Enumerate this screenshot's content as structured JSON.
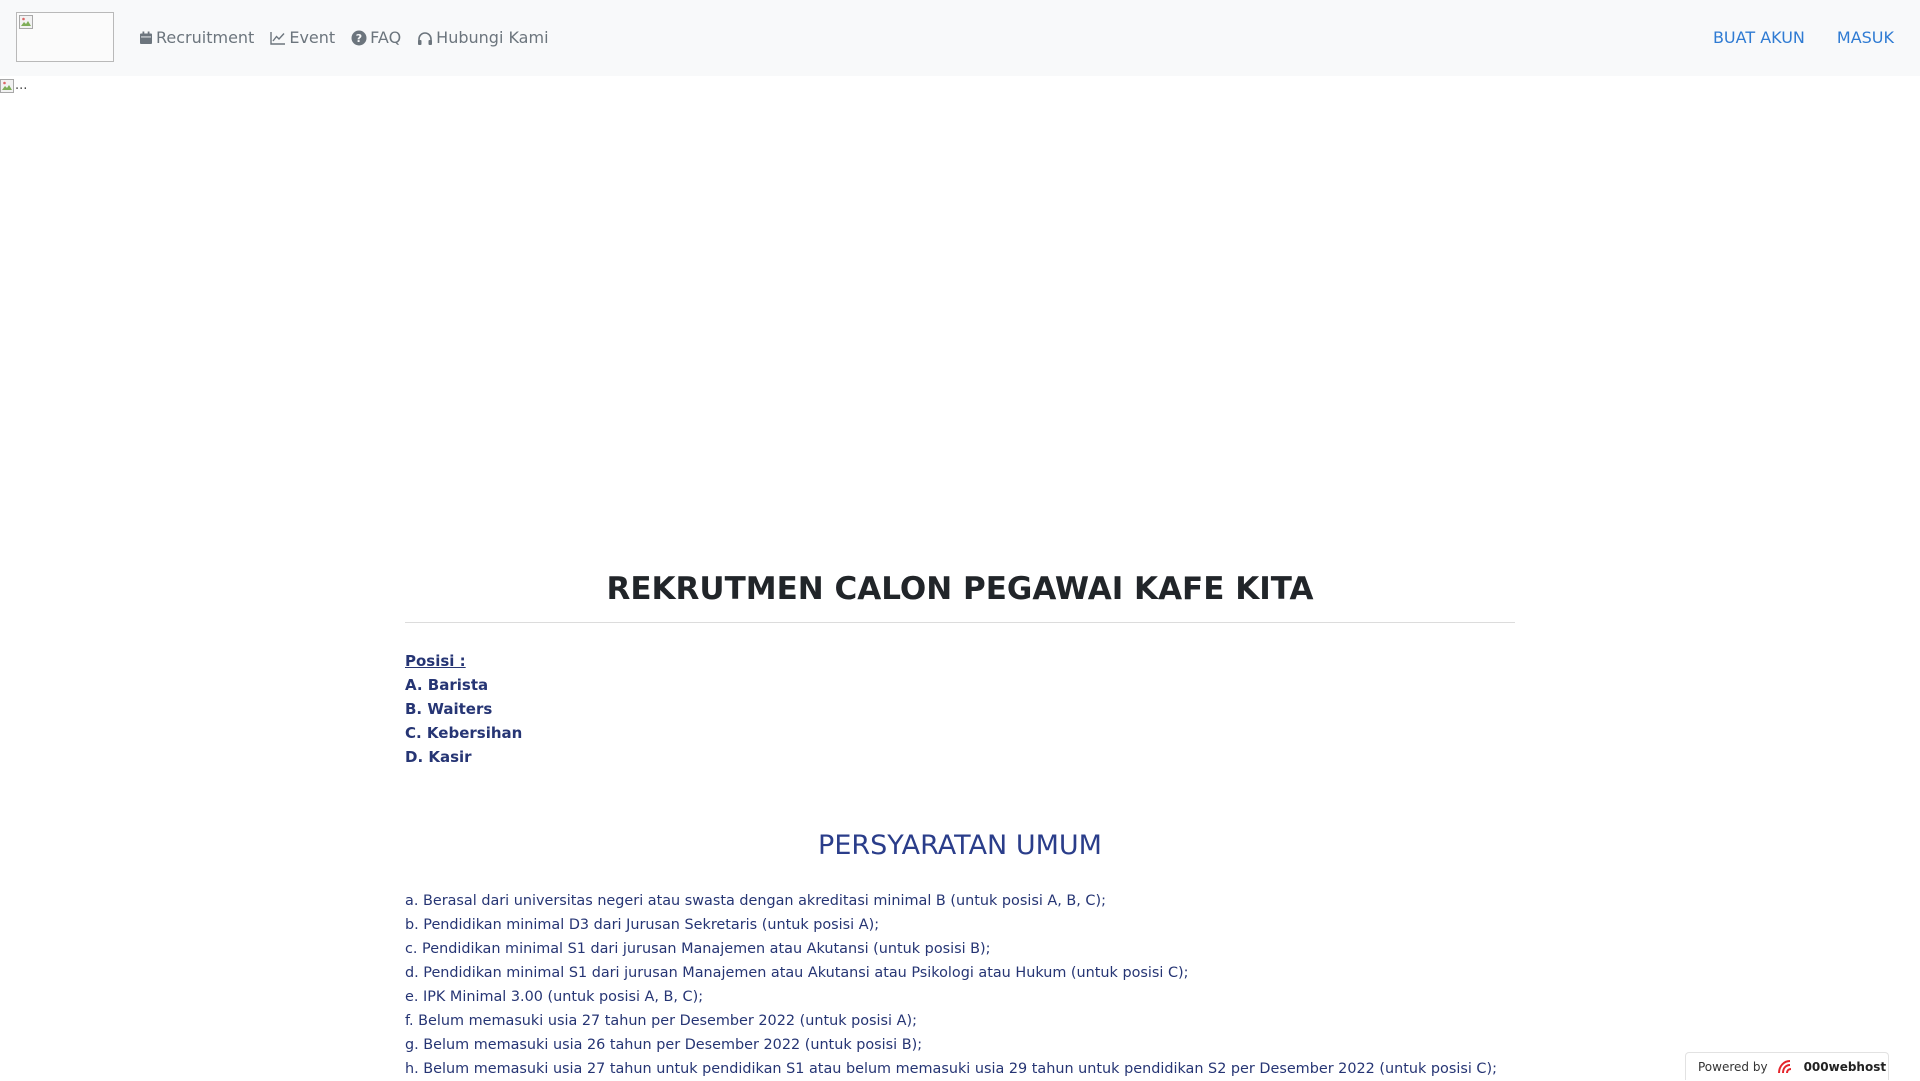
{
  "navbar": {
    "logo_alt": "",
    "links": [
      {
        "label": "Recruitment",
        "icon": "calendar-icon"
      },
      {
        "label": "Event",
        "icon": "line-chart-icon"
      },
      {
        "label": "FAQ",
        "icon": "question-circle-icon"
      },
      {
        "label": "Hubungi Kami",
        "icon": "headphones-icon"
      }
    ],
    "right_links": [
      "BUAT AKUN",
      "MASUK"
    ]
  },
  "hero": {
    "alt_text": "..."
  },
  "main": {
    "title": "REKRUTMEN CALON PEGAWAI KAFE KITA",
    "posisi": {
      "heading": "Posisi :",
      "items": [
        "A. Barista",
        "B. Waiters",
        "C. Kebersihan",
        "D. Kasir"
      ]
    },
    "persyaratan": {
      "title": "PERSYARATAN UMUM",
      "items": [
        "a. Berasal dari universitas negeri atau swasta dengan akreditasi minimal B (untuk posisi A, B, C);",
        "b. Pendidikan minimal D3 dari Jurusan Sekretaris (untuk posisi A);",
        "c. Pendidikan minimal S1 dari jurusan Manajemen atau Akutansi (untuk posisi B);",
        "d. Pendidikan minimal S1 dari jurusan Manajemen atau Akutansi atau Psikologi atau Hukum (untuk posisi C);",
        "e. IPK Minimal 3.00 (untuk posisi A, B, C);",
        "f. Belum memasuki usia 27 tahun per Desember 2022 (untuk posisi A);",
        "g. Belum memasuki usia 26 tahun per Desember 2022 (untuk posisi B);",
        "h. Belum memasuki usia 27 tahun untuk pendidikan S1 atau belum memasuki usia 29 tahun untuk pendidikan S2 per Desember 2022 (untuk posisi C);"
      ]
    }
  },
  "footer_badge": {
    "prefix": "Powered by",
    "brand": "000webhost",
    "icon": "000webhost-logo-icon"
  },
  "colors": {
    "navbar_bg": "#f8f9fa",
    "nav_text": "#6c757d",
    "nav_right_link": "#2f7bd3",
    "body_text": "#263574",
    "title_text": "#212529",
    "section_title": "#2a3d8a",
    "brand_red": "#e4252c"
  }
}
